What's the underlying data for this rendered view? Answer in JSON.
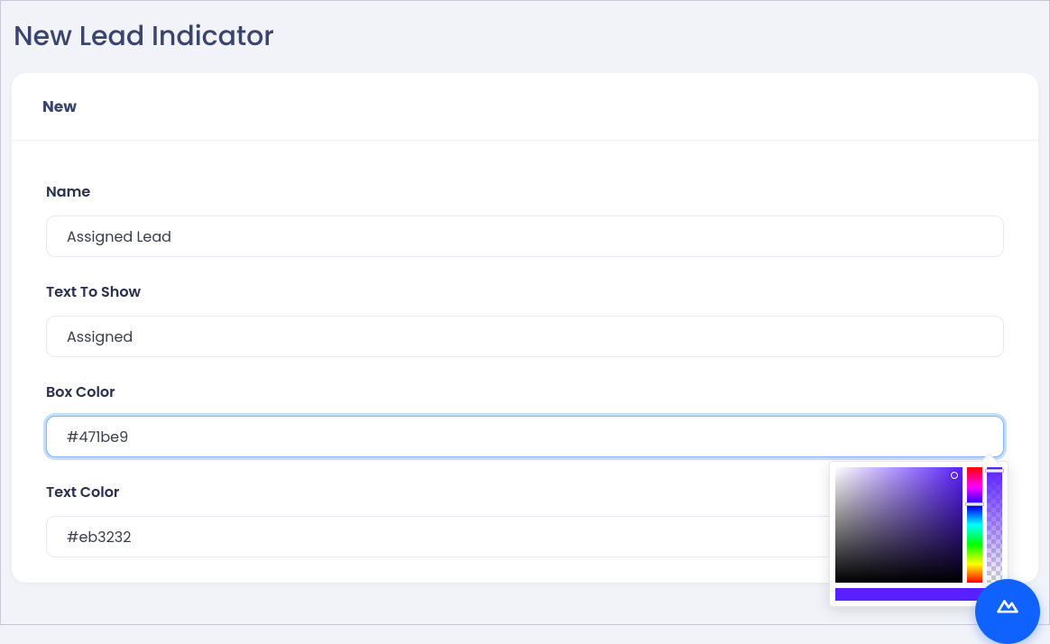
{
  "page": {
    "title": "New Lead Indicator"
  },
  "card": {
    "header_title": "New",
    "fields": {
      "name": {
        "label": "Name",
        "value": "Assigned Lead"
      },
      "text_to_show": {
        "label": "Text To Show",
        "value": "Assigned"
      },
      "box_color": {
        "label": "Box Color",
        "value": "#471be9"
      },
      "text_color": {
        "label": "Text Color",
        "value": "#eb3232"
      }
    }
  },
  "color_picker": {
    "current_hex": "#471be9"
  }
}
